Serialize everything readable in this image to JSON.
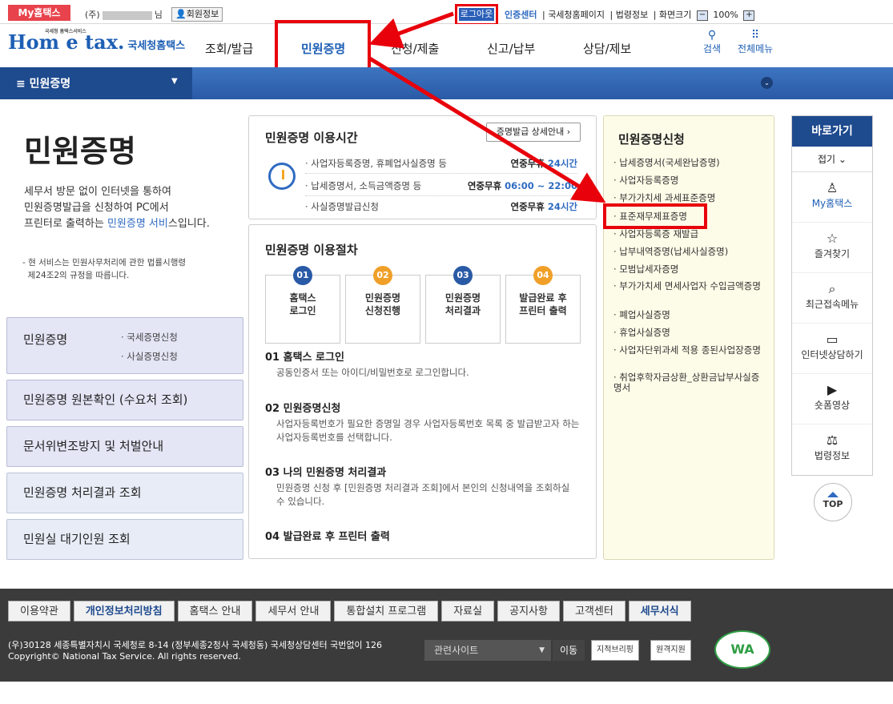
{
  "topbar": {
    "my": "My홈택스",
    "user_prefix": "(주)",
    "user_suffix": "님",
    "member": "회원정보",
    "logout": "로그아웃",
    "cert": "인증센터",
    "links": [
      "국세청홈페이지",
      "법령정보",
      "화면크기"
    ],
    "zoom": "100%",
    "minus": "−",
    "plus": "+"
  },
  "header": {
    "logo": "Hom e tax.",
    "logo_kor": "국세청홈택스",
    "logo_small": "국세청 홈택스서비스",
    "nav": [
      "조회/발급",
      "민원증명",
      "신청/제출",
      "신고/납부",
      "상담/제보"
    ],
    "search": "검색",
    "allmenu": "전체메뉴"
  },
  "bar": {
    "title": "≡  민원증명"
  },
  "main": {
    "title": "민원증명",
    "desc": [
      "세무서 방문 없이 인터넷을 통하여",
      "민원증명발급을 신청하여 PC에서",
      "프린터로 출력하는 ",
      "민원증명 서비",
      "스입니다."
    ],
    "note": [
      "- 현 서비스는 민원사무처리에 관한 법률시행령",
      "  제24조2의 규정을 따릅니다."
    ]
  },
  "leftmenu": {
    "items": [
      "민원증명",
      "민원증명 원본확인 (수요처 조회)",
      "문서위변조방지 및 처벌안내",
      "민원증명 처리결과 조회",
      "민원실 대기인원 조회"
    ],
    "subs": [
      "· 국세증명신청",
      "· 사실증명신청"
    ]
  },
  "hours": {
    "title": "민원증명 이용시간",
    "detail": "증명발급 상세안내 ›",
    "rows": [
      {
        "label": "· 사업자등록증명, 휴폐업사실증명 등",
        "value": "연중무휴 ",
        "value_b": "24시간"
      },
      {
        "label": "· 납세증명서, 소득금액증명 등",
        "value": "연중무휴 ",
        "value_b": "06:00 ~ 22:00"
      },
      {
        "label": "· 사실증명발급신청",
        "value": "연중무휴 ",
        "value_b": "24시간"
      }
    ]
  },
  "proc": {
    "title": "민원증명 이용절차",
    "steps": [
      {
        "n": "01",
        "a": "홈택스",
        "b": "로그인"
      },
      {
        "n": "02",
        "a": "민원증명",
        "b": "신청진행"
      },
      {
        "n": "03",
        "a": "민원증명",
        "b": "처리결과"
      },
      {
        "n": "04",
        "a": "발급완료 후",
        "b": "프린터 출력"
      }
    ],
    "sections": [
      {
        "t": "01 홈택스 로그인",
        "d": "공동인증서 또는 아이디/비밀번호로 로그인합니다."
      },
      {
        "t": "02 민원증명신청",
        "d": "사업자등록번호가 필요한 증명일 경우 사업자등록번호 목록 중 발급받고자 하는 사업자등록번호를 선택합니다."
      },
      {
        "t": "03 나의 민원증명 처리결과",
        "d": "민원증명 신청 후 [민원증명 처리결과 조회]에서 본인의 신청내역을 조회하실 수 있습니다."
      },
      {
        "t": "04 발급완료 후 프린터 출력",
        "d": ""
      }
    ]
  },
  "apply": {
    "title": "민원증명신청",
    "items": [
      "· 납세증명서(국세완납증명)",
      "· 사업자등록증명",
      "· 부가가치세 과세표준증명",
      "· 표준재무제표증명",
      "· 사업자등록증 재발급",
      "· 납부내역증명(납세사실증명)",
      "· 모범납세자증명",
      "· 부가가치세 면세사업자 수입금액증명",
      "· 폐업사실증명",
      "· 휴업사실증명",
      "· 사업자단위과세 적용 종된사업장증명",
      "· 취업후학자금상환_상환금납부사실증명서"
    ]
  },
  "quick": {
    "title": "바로가기",
    "fold": "접기 ⌄",
    "items": [
      "My홈택스",
      "즐겨찾기",
      "최근접속메뉴",
      "인터넷상담하기",
      "숏폼영상",
      "법령정보"
    ],
    "top": "TOP"
  },
  "footer": {
    "links": [
      "이용약관",
      "개인정보처리방침",
      "홈택스 안내",
      "세무서 안내",
      "통합설치 프로그램",
      "자료실",
      "공지사항",
      "고객센터",
      "세무서식"
    ],
    "addr1": "(우)30128 세종특별자치시 국세청로 8-14 (정부세종2청사 국세청동) 국세청상담센터 국번없이 126",
    "addr2": "Copyright© National Tax Service. All rights reserved.",
    "select": "관련사이트",
    "move": "이동",
    "btn1": "지적브리핑",
    "btn2": "원격지원",
    "wa": "WA"
  }
}
